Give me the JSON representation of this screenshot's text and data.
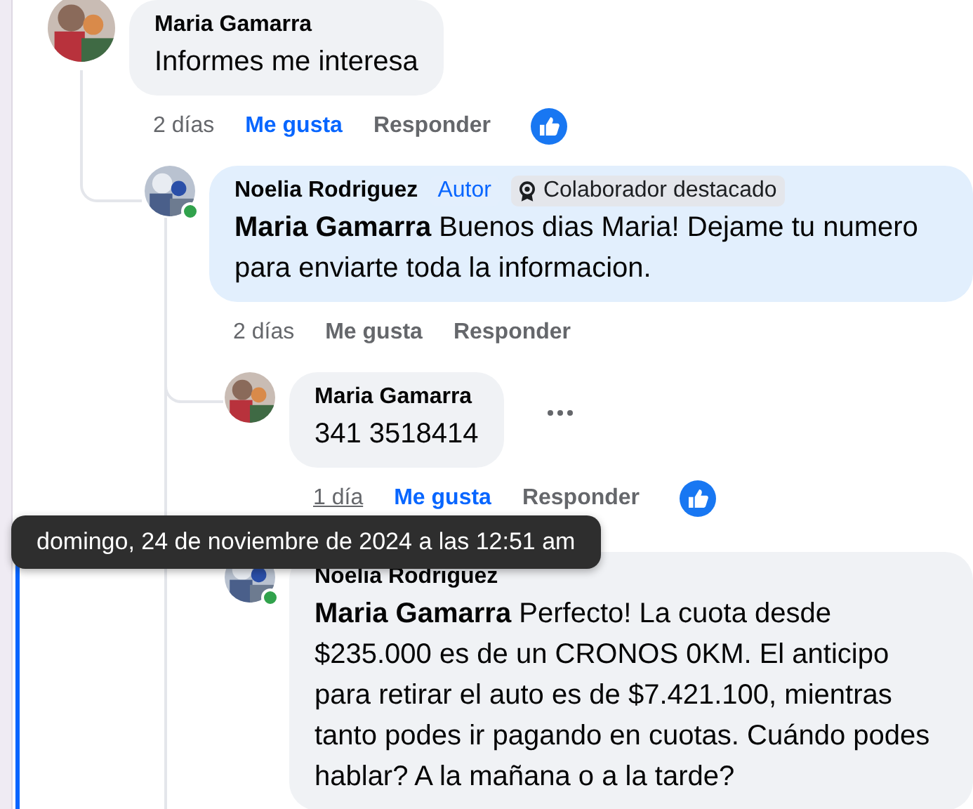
{
  "comments": [
    {
      "author": "Maria Gamarra",
      "text": "Informes me interesa",
      "time": "2 días",
      "like": "Me gusta",
      "reply": "Responder",
      "liked": true,
      "reaction_shown": true,
      "children": [
        {
          "author": "Noelia Rodriguez",
          "online": true,
          "highlighted": true,
          "badges": [
            {
              "kind": "role",
              "label": "Autor"
            },
            {
              "kind": "award",
              "label": "Colaborador destacado"
            }
          ],
          "text": "**Maria Gamarra** Buenos dias Maria! Dejame tu numero para enviarte toda la informacion.",
          "time": "2 días",
          "like": "Me gusta",
          "reply": "Responder",
          "liked": false,
          "reaction_shown": false,
          "children": [
            {
              "author": "Maria Gamarra",
              "text": "341 3518414",
              "time": "1 día",
              "time_hovered": true,
              "menu_shown": true,
              "like": "Me gusta",
              "reply": "Responder",
              "liked": true,
              "reaction_shown": true
            },
            {
              "author": "Noelia Rodriguez",
              "online": true,
              "highlighted": false,
              "focused": true,
              "text": "**Maria Gamarra** Perfecto! La cuota desde $235.000 es de un CRONOS 0KM. El anticipo para retirar el auto es de $7.421.100, mientras tanto podes ir pagando en cuotas. Cuándo podes hablar? A la mañana o a la tarde?"
            }
          ]
        }
      ]
    }
  ],
  "tooltip": {
    "text": "domingo, 24 de noviembre de 2024 a las 12:51 am"
  }
}
